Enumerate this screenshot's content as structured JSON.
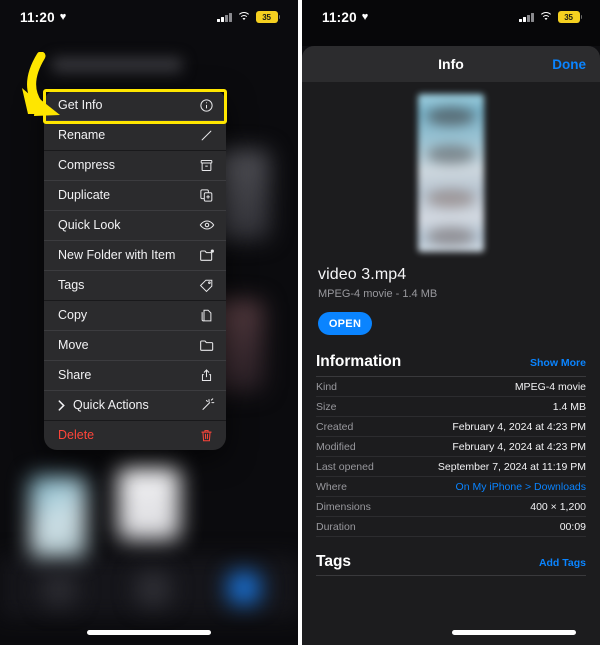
{
  "status_bar": {
    "time": "11:20",
    "heart_icon": "heart-icon",
    "battery_percent": "35",
    "signal_icon": "cellular-signal-icon",
    "wifi_icon": "wifi-icon"
  },
  "left_panel": {
    "annotation": {
      "highlight_color": "#ffe600",
      "arrow_icon": "curved-arrow-icon",
      "target_label": "Get Info"
    },
    "context_menu": {
      "items": [
        {
          "label": "Get Info",
          "icon": "info-circle-icon",
          "group": 0,
          "destructive": false,
          "has_submenu": false
        },
        {
          "label": "Rename",
          "icon": "pencil-icon",
          "group": 0,
          "destructive": false,
          "has_submenu": false
        },
        {
          "label": "Compress",
          "icon": "archive-box-icon",
          "group": 1,
          "destructive": false,
          "has_submenu": false
        },
        {
          "label": "Duplicate",
          "icon": "duplicate-icon",
          "group": 1,
          "destructive": false,
          "has_submenu": false
        },
        {
          "label": "Quick Look",
          "icon": "eye-icon",
          "group": 1,
          "destructive": false,
          "has_submenu": false
        },
        {
          "label": "New Folder with Item",
          "icon": "new-folder-icon",
          "group": 1,
          "destructive": false,
          "has_submenu": false
        },
        {
          "label": "Tags",
          "icon": "tag-icon",
          "group": 1,
          "destructive": false,
          "has_submenu": false
        },
        {
          "label": "Copy",
          "icon": "copy-icon",
          "group": 2,
          "destructive": false,
          "has_submenu": false
        },
        {
          "label": "Move",
          "icon": "folder-icon",
          "group": 2,
          "destructive": false,
          "has_submenu": false
        },
        {
          "label": "Share",
          "icon": "share-icon",
          "group": 2,
          "destructive": false,
          "has_submenu": false
        },
        {
          "label": "Quick Actions",
          "icon": "magic-wand-icon",
          "group": 2,
          "destructive": false,
          "has_submenu": true
        },
        {
          "label": "Delete",
          "icon": "trash-icon",
          "group": 3,
          "destructive": true,
          "has_submenu": false
        }
      ]
    }
  },
  "right_panel": {
    "sheet": {
      "title": "Info",
      "done_label": "Done"
    },
    "file": {
      "thumbnail_icon": "video-thumbnail",
      "name": "video 3.mp4",
      "subtitle": "MPEG-4 movie - 1.4 MB",
      "open_button": "OPEN"
    },
    "information": {
      "title": "Information",
      "action": "Show More",
      "rows": [
        {
          "key": "Kind",
          "value": "MPEG-4 movie",
          "link": false
        },
        {
          "key": "Size",
          "value": "1.4 MB",
          "link": false
        },
        {
          "key": "Created",
          "value": "February 4, 2024 at 4:23 PM",
          "link": false
        },
        {
          "key": "Modified",
          "value": "February 4, 2024 at 4:23 PM",
          "link": false
        },
        {
          "key": "Last opened",
          "value": "September 7, 2024 at 11:19 PM",
          "link": false
        },
        {
          "key": "Where",
          "value": "On My iPhone > Downloads",
          "link": true
        },
        {
          "key": "Dimensions",
          "value": "400 × 1,200",
          "link": false
        },
        {
          "key": "Duration",
          "value": "00:09",
          "link": false
        }
      ]
    },
    "tags": {
      "title": "Tags",
      "action": "Add Tags"
    }
  },
  "colors": {
    "accent_blue": "#0a84ff",
    "highlight_yellow": "#ffe600",
    "destructive_red": "#ff453a",
    "battery_yellow": "#f5d020"
  }
}
